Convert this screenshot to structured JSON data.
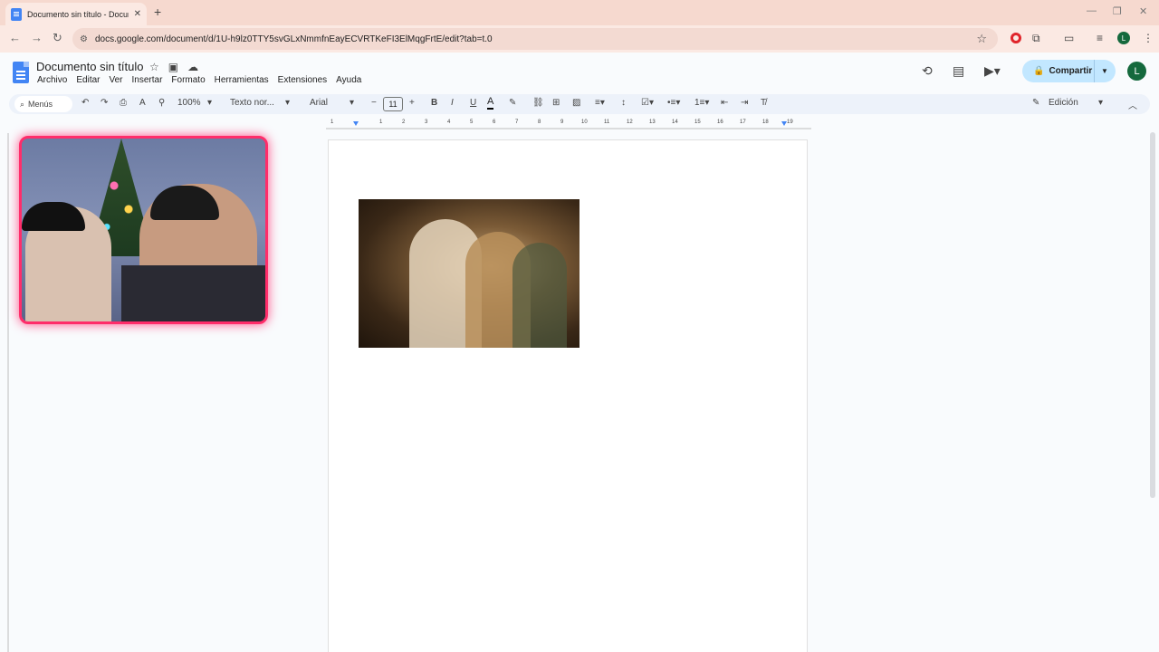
{
  "browser": {
    "tab_title": "Documento sin título - Documentos de Google",
    "url": "docs.google.com/document/d/1U-h9lz0TTY5svGLxNmmfnEayECVRTKeFI3ElMqgFrtE/edit?tab=t.0",
    "profile_initial": "L"
  },
  "docs": {
    "title": "Documento sin título",
    "menu": [
      "Archivo",
      "Editar",
      "Ver",
      "Insertar",
      "Formato",
      "Herramientas",
      "Extensiones",
      "Ayuda"
    ],
    "share_label": "Compartir",
    "avatar_initial": "L"
  },
  "toolbar": {
    "search_label": "Menús",
    "zoom": "100%",
    "style": "Texto nor...",
    "font": "Arial",
    "font_size": "11",
    "mode": "Edición"
  },
  "ruler": {
    "labels": [
      "1",
      "1",
      "2",
      "3",
      "4",
      "5",
      "6",
      "7",
      "8",
      "9",
      "10",
      "11",
      "12",
      "13",
      "14",
      "15",
      "16",
      "17",
      "18",
      "19"
    ]
  },
  "colors": {
    "accent": "#c2e7ff",
    "docs_blue": "#4285f4",
    "avatar_green": "#15693d",
    "webcam_border": "#ff2d6a"
  }
}
